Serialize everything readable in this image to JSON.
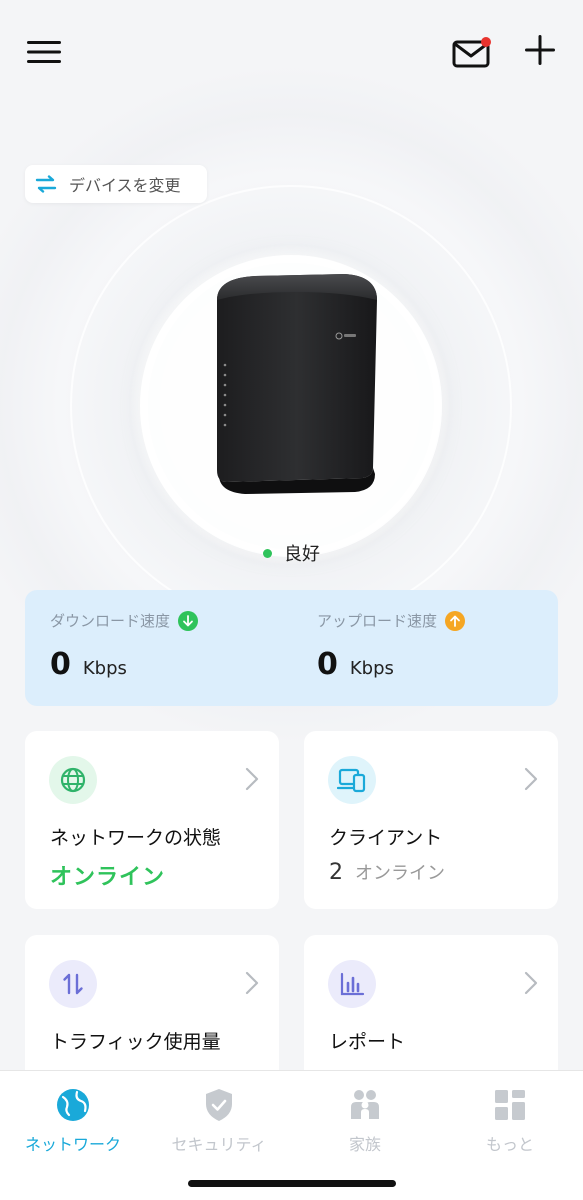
{
  "header": {
    "menu_icon": "hamburger-menu-icon",
    "mail_icon": "mail-icon",
    "add_icon": "plus-icon"
  },
  "device_switch": {
    "label": "デバイスを変更",
    "icon": "swap-arrows-icon"
  },
  "router": {
    "image": "router-device",
    "status": "良好",
    "status_color": "#2fc35b"
  },
  "speed": {
    "download": {
      "label": "ダウンロード速度",
      "value": "0",
      "unit": "Kbps",
      "icon_color": "#2fc35b"
    },
    "upload": {
      "label": "アップロード速度",
      "value": "0",
      "unit": "Kbps",
      "icon_color": "#f5a623"
    }
  },
  "tiles": {
    "network": {
      "title": "ネットワークの状態",
      "status": "オンライン",
      "icon": "globe-icon"
    },
    "clients": {
      "title": "クライアント",
      "count": "2",
      "status": "オンライン",
      "icon": "devices-icon"
    },
    "traffic": {
      "title": "トラフィック使用量",
      "icon": "traffic-arrows-icon"
    },
    "report": {
      "title": "レポート",
      "icon": "bar-chart-icon"
    }
  },
  "tabbar": {
    "items": [
      {
        "label": "ネットワーク",
        "icon": "globe-icon",
        "active": true
      },
      {
        "label": "セキュリティ",
        "icon": "shield-icon",
        "active": false
      },
      {
        "label": "家族",
        "icon": "family-icon",
        "active": false
      },
      {
        "label": "もっと",
        "icon": "grid-icon",
        "active": false
      }
    ]
  },
  "colors": {
    "accent": "#1aa9d9",
    "green": "#2fc35b",
    "orange": "#f5a623",
    "speed_bg": "#dceefc"
  }
}
